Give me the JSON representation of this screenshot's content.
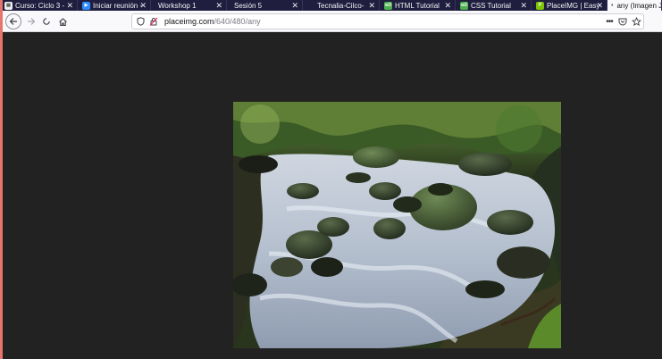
{
  "tabs": [
    {
      "title": "Curso: Ciclo 3 -",
      "icon": "book-icon",
      "color": "#f0f0f0"
    },
    {
      "title": "Iniciar reunión -",
      "icon": "video-icon",
      "color": "#2d8cff"
    },
    {
      "title": "Workshop 1",
      "icon": "",
      "color": ""
    },
    {
      "title": "Sesión 5",
      "icon": "",
      "color": ""
    },
    {
      "title": "Tecnalia-Cilco-",
      "icon": "",
      "color": ""
    },
    {
      "title": "HTML Tutorial",
      "icon": "w3schools-icon",
      "color": "#4caf50"
    },
    {
      "title": "CSS Tutorial",
      "icon": "w3schools-icon",
      "color": "#4caf50"
    },
    {
      "title": "PlaceIMG | Easy",
      "icon": "placeimg-icon",
      "color": "#7cc400"
    },
    {
      "title": "any (Imagen J",
      "icon": "",
      "color": ""
    }
  ],
  "url": {
    "domain": "placeimg.com",
    "path": "/640/480/any"
  },
  "colors": {
    "tab_bg": "#1f1e3e",
    "page_bg": "#232222",
    "accent_edge": "#e8756b"
  }
}
